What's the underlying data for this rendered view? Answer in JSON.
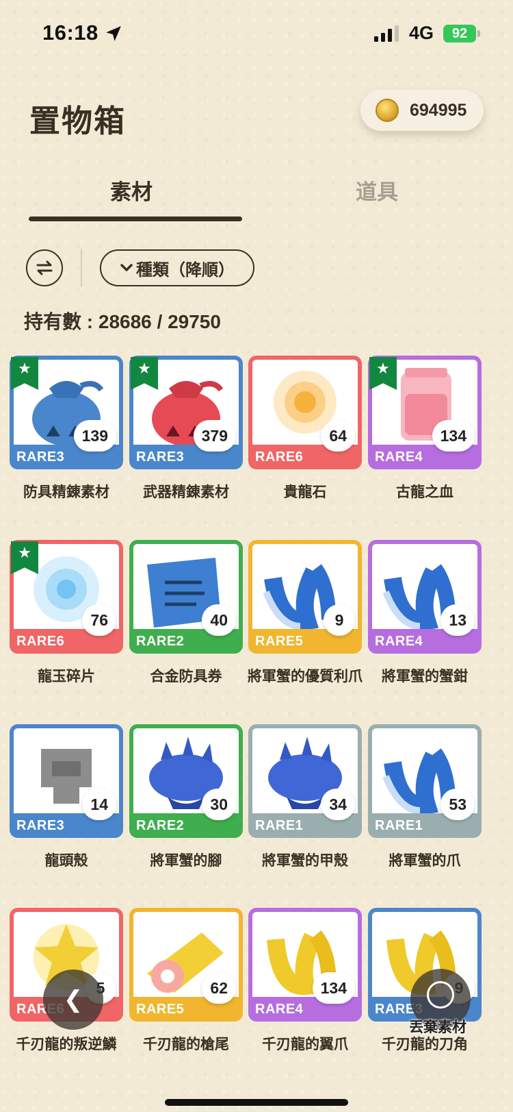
{
  "status_bar": {
    "time": "16:18",
    "network": "4G",
    "battery": "92"
  },
  "header": {
    "title": "置物箱",
    "coins": "694995"
  },
  "tabs": [
    {
      "label": "素材",
      "active": true
    },
    {
      "label": "道具",
      "active": false
    }
  ],
  "filter": {
    "sort_label": "種類（降順）"
  },
  "inventory_count": "持有數 : 28686 / 29750",
  "rarity_colors": {
    "RARE1": "#9aaeb0",
    "RARE2": "#3fae4e",
    "RARE3": "#4a86cc",
    "RARE4": "#b66de0",
    "RARE5": "#f1b52f",
    "RARE6": "#f06565"
  },
  "items": [
    {
      "name": "防具精錬素材",
      "rarity": "RARE3",
      "qty": "139",
      "favorite": true,
      "icon": "blue-pouch-icon"
    },
    {
      "name": "武器精錬素材",
      "rarity": "RARE3",
      "qty": "379",
      "favorite": true,
      "icon": "red-pouch-icon"
    },
    {
      "name": "貴龍石",
      "rarity": "RARE6",
      "qty": "64",
      "favorite": false,
      "icon": "sun-gem-icon"
    },
    {
      "name": "古龍之血",
      "rarity": "RARE4",
      "qty": "134",
      "favorite": true,
      "icon": "blood-jar-icon"
    },
    {
      "name": "龍玉碎片",
      "rarity": "RARE6",
      "qty": "76",
      "favorite": true,
      "icon": "ice-shard-icon"
    },
    {
      "name": "合金防具券",
      "rarity": "RARE2",
      "qty": "40",
      "favorite": false,
      "icon": "ticket-scroll-icon"
    },
    {
      "name": "將軍蟹的優質利爪",
      "rarity": "RARE5",
      "qty": "9",
      "favorite": false,
      "icon": "blue-claw-icon"
    },
    {
      "name": "將軍蟹的蟹鉗",
      "rarity": "RARE4",
      "qty": "13",
      "favorite": false,
      "icon": "blue-claw-icon"
    },
    {
      "name": "龍頭殼",
      "rarity": "RARE3",
      "qty": "14",
      "favorite": false,
      "icon": "skull-shell-icon"
    },
    {
      "name": "將軍蟹的腳",
      "rarity": "RARE2",
      "qty": "30",
      "favorite": false,
      "icon": "spiked-shell-icon"
    },
    {
      "name": "將軍蟹的甲殼",
      "rarity": "RARE1",
      "qty": "34",
      "favorite": false,
      "icon": "spiked-shell-icon"
    },
    {
      "name": "將軍蟹的爪",
      "rarity": "RARE1",
      "qty": "53",
      "favorite": false,
      "icon": "blue-claw-icon"
    },
    {
      "name": "千刃龍的叛逆鱗",
      "rarity": "RARE6",
      "qty": "5",
      "favorite": false,
      "icon": "gold-scale-icon"
    },
    {
      "name": "千刃龍的槍尾",
      "rarity": "RARE5",
      "qty": "62",
      "favorite": false,
      "icon": "gold-tail-icon"
    },
    {
      "name": "千刃龍的翼爪",
      "rarity": "RARE4",
      "qty": "134",
      "favorite": false,
      "icon": "gold-claw-icon"
    },
    {
      "name": "千刃龍的刀角",
      "rarity": "RARE3",
      "qty": "9",
      "favorite": false,
      "icon": "gold-claw-icon"
    }
  ],
  "fab": {
    "back_icon": "chevron-left-icon",
    "discard_label": "丟棄素材",
    "discard_icon": "trash-material-icon"
  }
}
